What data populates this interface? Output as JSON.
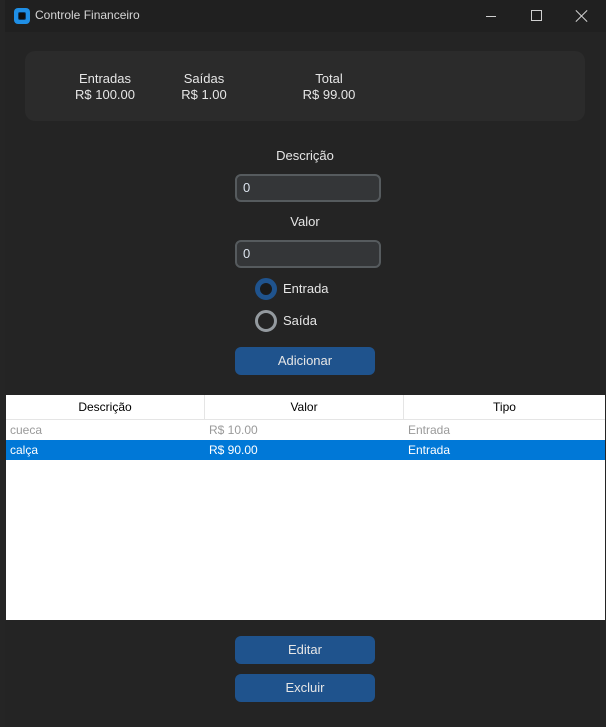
{
  "window": {
    "title": "Controle Financeiro"
  },
  "summary": {
    "entradas_label": "Entradas",
    "entradas_value": "R$ 100.00",
    "saidas_label": "Saídas",
    "saidas_value": "R$ 1.00",
    "total_label": "Total",
    "total_value": "R$ 99.00"
  },
  "form": {
    "descricao_label": "Descrição",
    "descricao_value": "0",
    "valor_label": "Valor",
    "valor_value": "0",
    "radio_entrada": "Entrada",
    "radio_saida": "Saída",
    "selected": "Entrada",
    "add_button": "Adicionar"
  },
  "table": {
    "columns": [
      "Descrição",
      "Valor",
      "Tipo"
    ],
    "rows": [
      [
        "cueca",
        "R$ 10.00",
        "Entrada"
      ],
      [
        "calça",
        "R$ 90.00",
        "Entrada"
      ]
    ],
    "selected_row": 1
  },
  "actions": {
    "edit_button": "Editar",
    "delete_button": "Excluir"
  },
  "colors": {
    "accent": "#1f538d",
    "selection": "#0078d7",
    "background": "#242424"
  }
}
